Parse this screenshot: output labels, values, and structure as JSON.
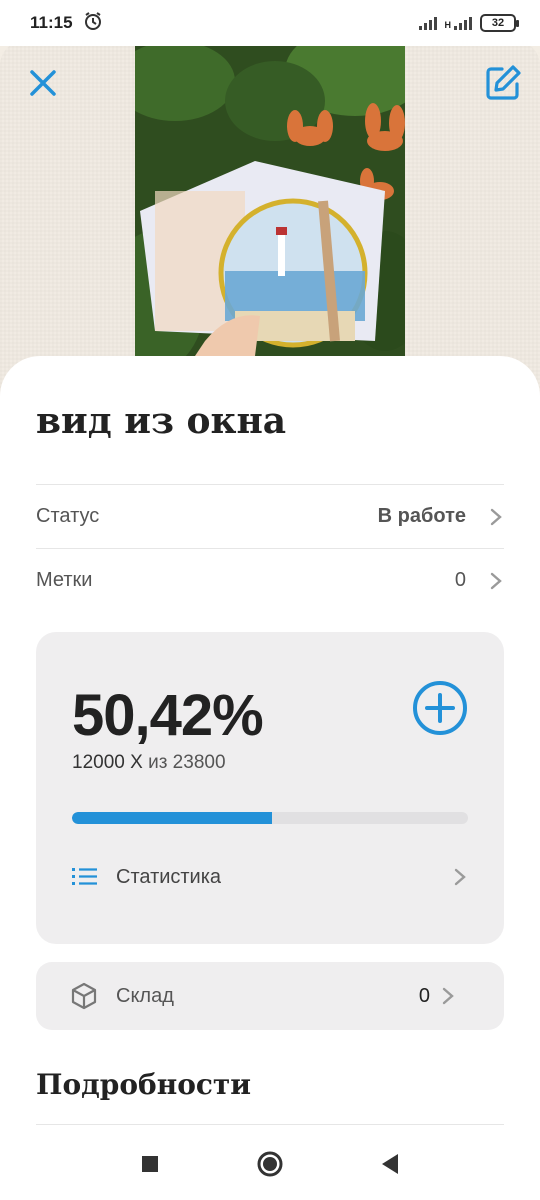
{
  "status_bar": {
    "time": "11:15",
    "battery": "32",
    "network_label": "H"
  },
  "header": {
    "close_icon": "close-icon",
    "edit_icon": "edit-icon",
    "accent_color": "#2391d8"
  },
  "project": {
    "title": "вид из окна",
    "status_label": "Статус",
    "status_value": "В работе",
    "tags_label": "Метки",
    "tags_value": "0"
  },
  "progress": {
    "percent_text": "50,42%",
    "done": "12000 X",
    "of_text": "из 23800",
    "fraction": 0.5042,
    "stats_label": "Статистика"
  },
  "storage": {
    "label": "Склад",
    "value": "0"
  },
  "details": {
    "title": "Подробности"
  }
}
